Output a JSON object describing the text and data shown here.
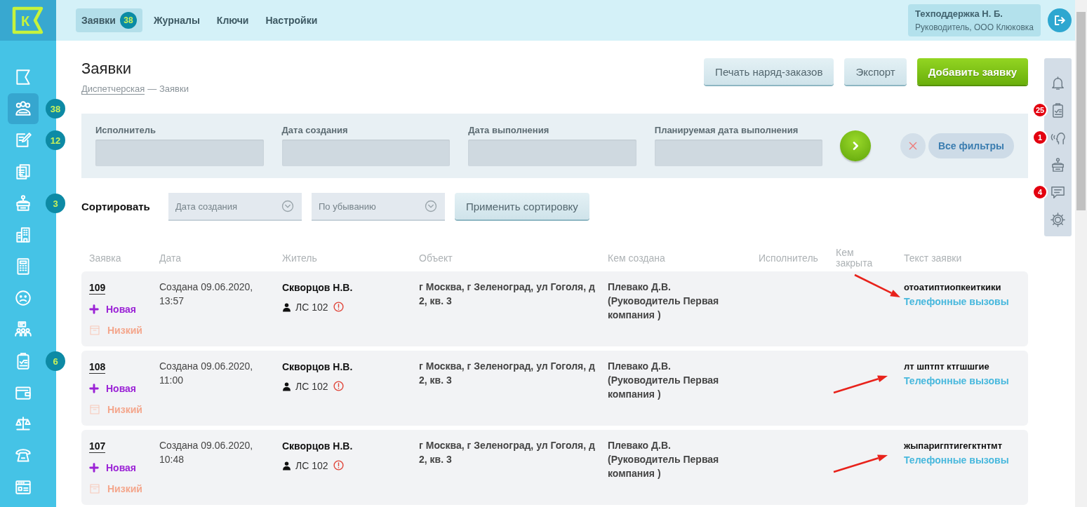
{
  "logo": {
    "letter": "К"
  },
  "sidebar": {
    "items": [
      {
        "selected": false
      },
      {
        "selected": true,
        "badge": "38"
      },
      {
        "selected": false,
        "badge": "12"
      },
      {
        "selected": false
      },
      {
        "selected": false,
        "badge": "3"
      },
      {
        "selected": false
      },
      {
        "selected": false
      },
      {
        "selected": false
      },
      {
        "selected": false
      },
      {
        "selected": false,
        "badge": "6"
      },
      {
        "selected": false
      },
      {
        "selected": false
      },
      {
        "selected": false
      },
      {
        "selected": false
      }
    ]
  },
  "top_nav": {
    "tabs": [
      {
        "label": "Заявки",
        "badge": "38",
        "selected": true
      },
      {
        "label": "Журналы",
        "selected": false
      },
      {
        "label": "Ключи",
        "selected": false
      },
      {
        "label": "Настройки",
        "selected": false
      }
    ],
    "user": {
      "name": "Техподдержка Н. Б.",
      "role": "Руководитель, ООО Клюковка"
    }
  },
  "page": {
    "title": "Заявки",
    "breadcrumb": {
      "link": "Диспетчерская",
      "current": "— Заявки"
    },
    "buttons": [
      {
        "label": "Печать наряд-заказов",
        "kind": "secondary"
      },
      {
        "label": "Экспорт",
        "kind": "secondary"
      },
      {
        "label": "Добавить заявку",
        "kind": "primary"
      }
    ]
  },
  "filters": {
    "fields": [
      {
        "label": "Исполнитель"
      },
      {
        "label": "Дата создания"
      },
      {
        "label": "Дата выполнения"
      },
      {
        "label": "Планируемая дата выполнения"
      }
    ],
    "all_filters": "Все фильтры"
  },
  "sort": {
    "label": "Сортировать",
    "selects": [
      {
        "value": "Дата создания"
      },
      {
        "value": "По убыванию"
      }
    ],
    "apply": "Применить сортировку"
  },
  "table": {
    "columns": [
      "Заявка",
      "Дата",
      "Житель",
      "Объект",
      "Кем создана",
      "Исполнитель",
      "Кем закрыта",
      "Текст заявки"
    ],
    "rows": [
      {
        "number": "109",
        "status": "Новая",
        "priority": "Низкий",
        "date": "Создана 09.06.2020, 13:57",
        "resident": "Скворцов Н.В.",
        "account": "ЛС 102",
        "object": "г Москва, г Зеленоград, ул Гоголя, д 2, кв. 3",
        "created_by": "Плевако Д.В. (Руководитель Первая компания )",
        "text": "отоатиптиопкеиткики",
        "category": "Телефонные вызовы",
        "kind": "arrow-down"
      },
      {
        "number": "108",
        "status": "Новая",
        "priority": "Низкий",
        "date": "Создана 09.06.2020, 11:00",
        "resident": "Скворцов Н.В.",
        "account": "ЛС 102",
        "object": "г Москва, г Зеленоград, ул Гоголя, д 2, кв. 3",
        "created_by": "Плевако Д.В. (Руководитель Первая компания )",
        "text": "лт шптпт ктгшшгие",
        "category": "Телефонные вызовы",
        "kind": "arrow-up"
      },
      {
        "number": "107",
        "status": "Новая",
        "priority": "Низкий",
        "date": "Создана 09.06.2020, 10:48",
        "resident": "Скворцов Н.В.",
        "account": "ЛС 102",
        "object": "г Москва, г Зеленоград, ул Гоголя, д 2, кв. 3",
        "created_by": "Плевако Д.В. (Руководитель Первая компания )",
        "text": "жыпаригптигегктнтмт",
        "category": "Телефонные вызовы",
        "kind": "arrow-up"
      }
    ]
  },
  "right_rail": {
    "items": [
      {
        "badged": false
      },
      {
        "badged": true,
        "badge": "25"
      },
      {
        "badged": true,
        "badge": "1"
      },
      {
        "badged": false
      },
      {
        "badged": true,
        "badge": "4"
      },
      {
        "badged": false
      }
    ]
  }
}
